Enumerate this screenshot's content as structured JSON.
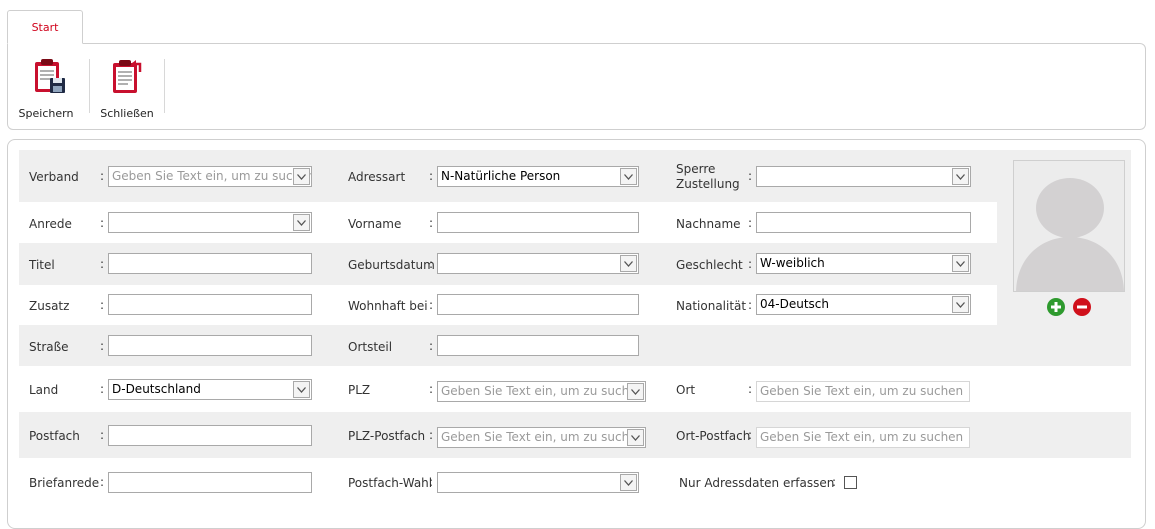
{
  "tabs": {
    "start": "Start"
  },
  "toolbar": {
    "save_label": "Speichern",
    "close_label": "Schließen"
  },
  "colon": ":",
  "form": {
    "verband": {
      "label": "Verband",
      "placeholder": "Geben Sie Text ein, um zu suchen"
    },
    "adressart": {
      "label": "Adressart",
      "value": "N-Natürliche Person"
    },
    "sperre_zustellung": {
      "label_line1": "Sperre",
      "label_line2": "Zustellung",
      "value": ""
    },
    "anrede": {
      "label": "Anrede",
      "value": ""
    },
    "vorname": {
      "label": "Vorname",
      "value": ""
    },
    "nachname": {
      "label": "Nachname",
      "value": ""
    },
    "titel": {
      "label": "Titel",
      "value": ""
    },
    "geburtsdatum": {
      "label": "Geburtsdatum",
      "value": ""
    },
    "geschlecht": {
      "label": "Geschlecht",
      "value": "W-weiblich"
    },
    "zusatz": {
      "label": "Zusatz",
      "value": ""
    },
    "wohnhaft_bei": {
      "label": "Wohnhaft bei",
      "value": ""
    },
    "nationalitaet": {
      "label": "Nationalität",
      "value": "04-Deutsch"
    },
    "strasse": {
      "label": "Straße",
      "value": ""
    },
    "ortsteil": {
      "label": "Ortsteil",
      "value": ""
    },
    "land": {
      "label": "Land",
      "value": "D-Deutschland"
    },
    "plz": {
      "label": "PLZ",
      "placeholder": "Geben Sie Text ein, um zu suchen"
    },
    "ort": {
      "label": "Ort",
      "placeholder": "Geben Sie Text ein, um zu suchen"
    },
    "postfach": {
      "label": "Postfach",
      "value": ""
    },
    "plz_postfach": {
      "label": "PLZ-Postfach",
      "placeholder": "Geben Sie Text ein, um zu suchen"
    },
    "ort_postfach": {
      "label": "Ort-Postfach",
      "placeholder": "Geben Sie Text ein, um zu suchen"
    },
    "briefanrede": {
      "label": "Briefanrede",
      "value": ""
    },
    "postfach_wahl": {
      "label": "Postfach-Wahl",
      "value": ""
    },
    "nur_adressdaten": {
      "label": "Nur Adressdaten erfassen",
      "checked": false
    }
  },
  "icons": {
    "save": "clipboard-save-icon",
    "close": "clipboard-close-icon",
    "avatar": "avatar-placeholder-icon",
    "add": "plus-circle-icon",
    "remove": "minus-circle-icon"
  },
  "colors": {
    "accent": "#d0021b",
    "band": "#efefef",
    "add": "#2e9a2e",
    "remove": "#d0101b"
  }
}
